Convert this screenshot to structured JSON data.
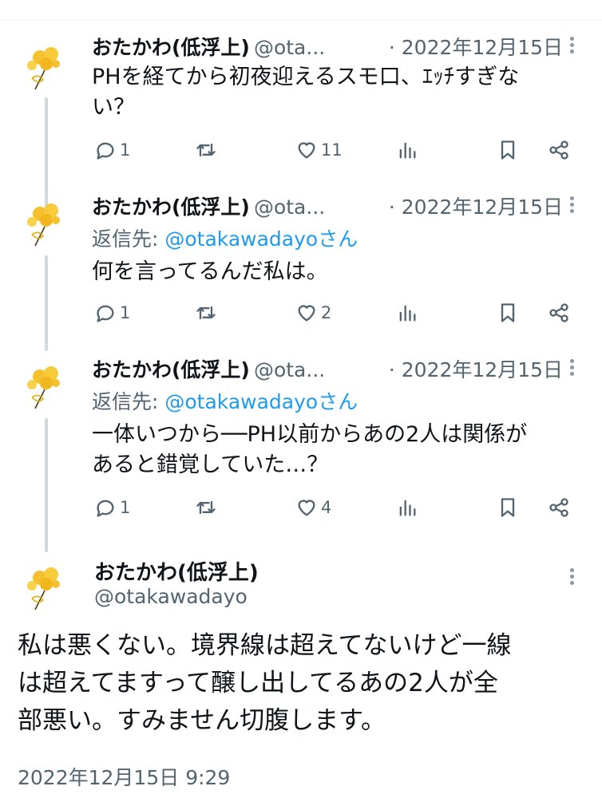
{
  "author": {
    "display_name": "おたかわ(低浮上)",
    "handle_truncated": "@ota...",
    "handle": "@otakawadayo"
  },
  "reply_prefix": "返信先: ",
  "reply_mention": "@otakawadayoさん",
  "tweets": [
    {
      "date": "· 2022年12月15日",
      "text_lines": [
        "PHを経てから初夜迎えるスモ口、ｴｯﾁすぎな",
        "い？"
      ],
      "replies": "1",
      "likes": "11"
    },
    {
      "date": "· 2022年12月15日",
      "text_lines": [
        "何を言ってるんだ私は。"
      ],
      "replies": "1",
      "likes": "2"
    },
    {
      "date": "· 2022年12月15日",
      "text_lines": [
        "一体いつから──PH以前からあの2人は関係が",
        "あると錯覚していた…？"
      ],
      "replies": "1",
      "likes": "4"
    }
  ],
  "main_tweet": {
    "text_lines": [
      "私は悪くない。境界線は超えてないけど一線",
      "は超えてますって醸し出してるあの2人が全",
      "部悪い。すみません切腹します。"
    ],
    "timestamp": "2022年12月15日 9:29"
  },
  "icons": [
    "flower-avatar",
    "reply-icon",
    "retweet-icon",
    "like-icon",
    "views-icon",
    "bookmark-icon",
    "share-icon",
    "more-icon"
  ],
  "colors": {
    "accent": "#1d9bf0",
    "secondary_text": "#536471",
    "thread_line": "#cfd9de",
    "avatar_yellow": "#f6c02e"
  }
}
